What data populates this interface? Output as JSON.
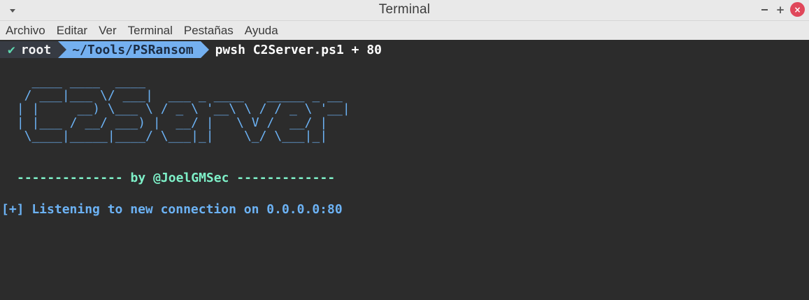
{
  "window": {
    "title": "Terminal"
  },
  "titlebar": {
    "menu_icon": "chevron-down-icon",
    "minimize_icon": "minimize-icon",
    "maximize_icon": "maximize-icon",
    "maximize_glyph": "+",
    "close_icon": "close-icon",
    "close_glyph": "×",
    "close_color": "#e0475a"
  },
  "menubar": {
    "items": [
      "Archivo",
      "Editar",
      "Ver",
      "Terminal",
      "Pestañas",
      "Ayuda"
    ]
  },
  "terminal": {
    "background": "#2c2c2c",
    "prompt": {
      "status_glyph": "✔",
      "user": "root",
      "path": "~/Tools/PSRansom",
      "command": "pwsh C2Server.ps1 + 80",
      "path_color": "#74b0f0"
    },
    "banner_color": "#6cb2f4",
    "banner_lines": [
      "   ____ ____  ____",
      "  / ___|___ \\/ ___|  ___ _ ____   _____ _ __",
      " | |     __) \\___ \\ / _ \\ '__\\ \\ / / _ \\ '__|",
      " | |___ / __/ ___) |  __/ |   \\ V /  __/ |",
      "  \\____|_____|____/ \\___|_|    \\_/ \\___|_|"
    ],
    "byline": "-------------- by @JoelGMSec -------------",
    "byline_color": "#7ef0c8",
    "status": "[+] Listening to new connection on 0.0.0.0:80"
  }
}
